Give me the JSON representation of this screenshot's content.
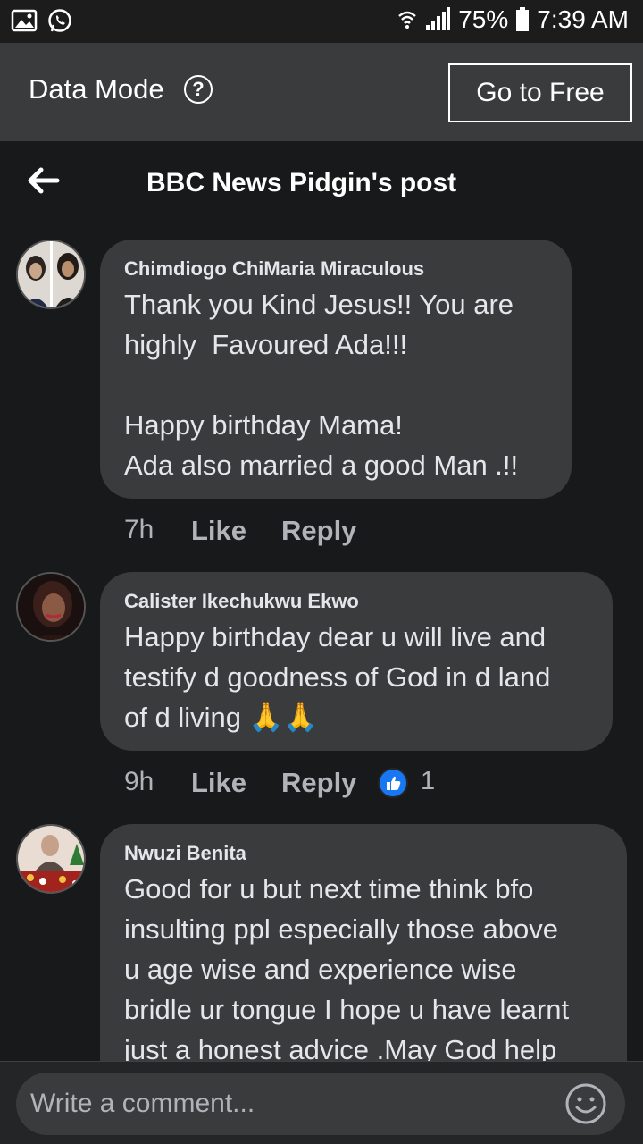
{
  "status_bar": {
    "battery": "75%",
    "time": "7:39 AM"
  },
  "data_mode": {
    "label": "Data Mode",
    "help_symbol": "?",
    "go_free_label": "Go to Free"
  },
  "header": {
    "title": "BBC News Pidgin's post"
  },
  "comments": [
    {
      "author": "Chimdiogo ChiMaria Miraculous",
      "text": "Thank you Kind Jesus!! You are\nhighly  Favoured Ada!!!\n\nHappy birthday Mama!\nAda also married a good Man .!!",
      "time": "7h",
      "like_label": "Like",
      "reply_label": "Reply"
    },
    {
      "author": "Calister Ikechukwu Ekwo",
      "text": "Happy birthday dear u will live and\ntestify d goodness of God in d land\nof d living 🙏🙏",
      "time": "9h",
      "like_label": "Like",
      "reply_label": "Reply",
      "reaction_count": "1"
    },
    {
      "author": "Nwuzi Benita",
      "text": "Good for u but next time think bfo\ninsulting ppl especially those above\nu age wise and experience wise\nbridle ur tongue I hope u have learnt\njust a honest advice .May God help"
    }
  ],
  "composer": {
    "placeholder": "Write a comment..."
  },
  "colors": {
    "background": "#18191a",
    "bubble": "#3a3b3c",
    "banner": "#3a3b3c",
    "like_blue": "#1877f2",
    "meta_gray": "#b0b3b8"
  }
}
